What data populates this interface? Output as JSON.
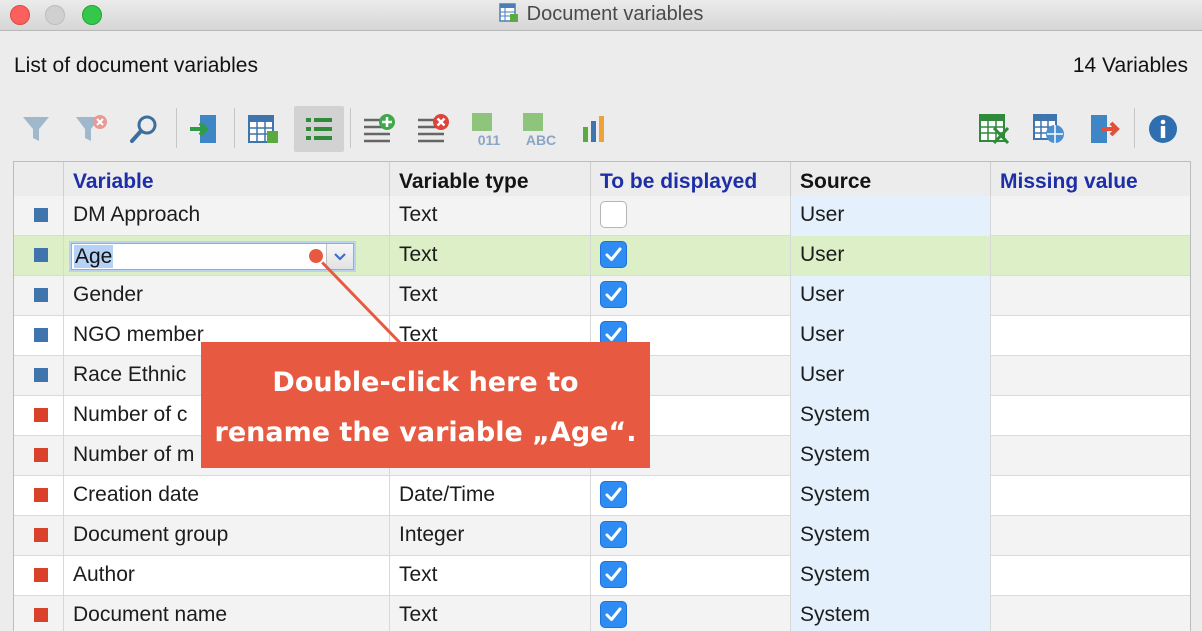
{
  "window": {
    "title": "Document variables",
    "icon": "table-icon",
    "controls": [
      "close",
      "minimize",
      "zoom"
    ]
  },
  "header": {
    "list_label": "List of document variables",
    "count_label": "14 Variables"
  },
  "toolbar": {
    "left_buttons": [
      "filter-icon",
      "clear-filter-icon",
      "search-icon",
      "import-icon",
      "table-view-icon",
      "list-view-icon",
      "add-variable-icon",
      "delete-variable-icon",
      "numeric-variable-icon",
      "text-variable-icon",
      "statistics-icon"
    ],
    "right_buttons": [
      "export-excel-icon",
      "export-web-icon",
      "export-icon",
      "info-icon"
    ],
    "numeric_glyph": "011",
    "text_glyph": "ABC",
    "active": "list-view-icon"
  },
  "table": {
    "columns": {
      "variable": "Variable",
      "type": "Variable type",
      "display": "To be displayed",
      "source": "Source",
      "missing": "Missing value"
    },
    "rows": [
      {
        "name": "DM Approach",
        "type": "Text",
        "displayed": false,
        "source": "User",
        "missing": "",
        "color": "#3f74ad"
      },
      {
        "name": "Age",
        "type": "Text",
        "displayed": true,
        "source": "User",
        "missing": "",
        "color": "#3f74ad"
      },
      {
        "name": "Gender",
        "type": "Text",
        "displayed": true,
        "source": "User",
        "missing": "",
        "color": "#3f74ad"
      },
      {
        "name": "NGO member",
        "type": "Text",
        "displayed": true,
        "source": "User",
        "missing": "",
        "color": "#3f74ad"
      },
      {
        "name": "Race Ethnic",
        "type": "",
        "displayed": null,
        "source": "User",
        "missing": "",
        "color": "#3f74ad"
      },
      {
        "name": "Number of c",
        "type": "",
        "displayed": null,
        "source": "System",
        "missing": "",
        "color": "#d9412b"
      },
      {
        "name": "Number of m",
        "type": "",
        "displayed": null,
        "source": "System",
        "missing": "",
        "color": "#d9412b"
      },
      {
        "name": "Creation date",
        "type": "Date/Time",
        "displayed": true,
        "source": "System",
        "missing": "",
        "color": "#d9412b"
      },
      {
        "name": "Document group",
        "type": "Integer",
        "displayed": true,
        "source": "System",
        "missing": "",
        "color": "#d9412b"
      },
      {
        "name": "Author",
        "type": "Text",
        "displayed": true,
        "source": "System",
        "missing": "",
        "color": "#d9412b"
      },
      {
        "name": "Document name",
        "type": "Text",
        "displayed": true,
        "source": "System",
        "missing": "",
        "color": "#d9412b"
      }
    ],
    "selected_row": 1,
    "editor_value": "Age"
  },
  "callout": {
    "line1": "Double-click here to",
    "line2": "rename the variable „Age“."
  },
  "colors": {
    "callout": "#e75a41",
    "selected_row": "#dcefc6",
    "header_blue": "#1d2ea6",
    "checkbox": "#2e8cf2"
  }
}
